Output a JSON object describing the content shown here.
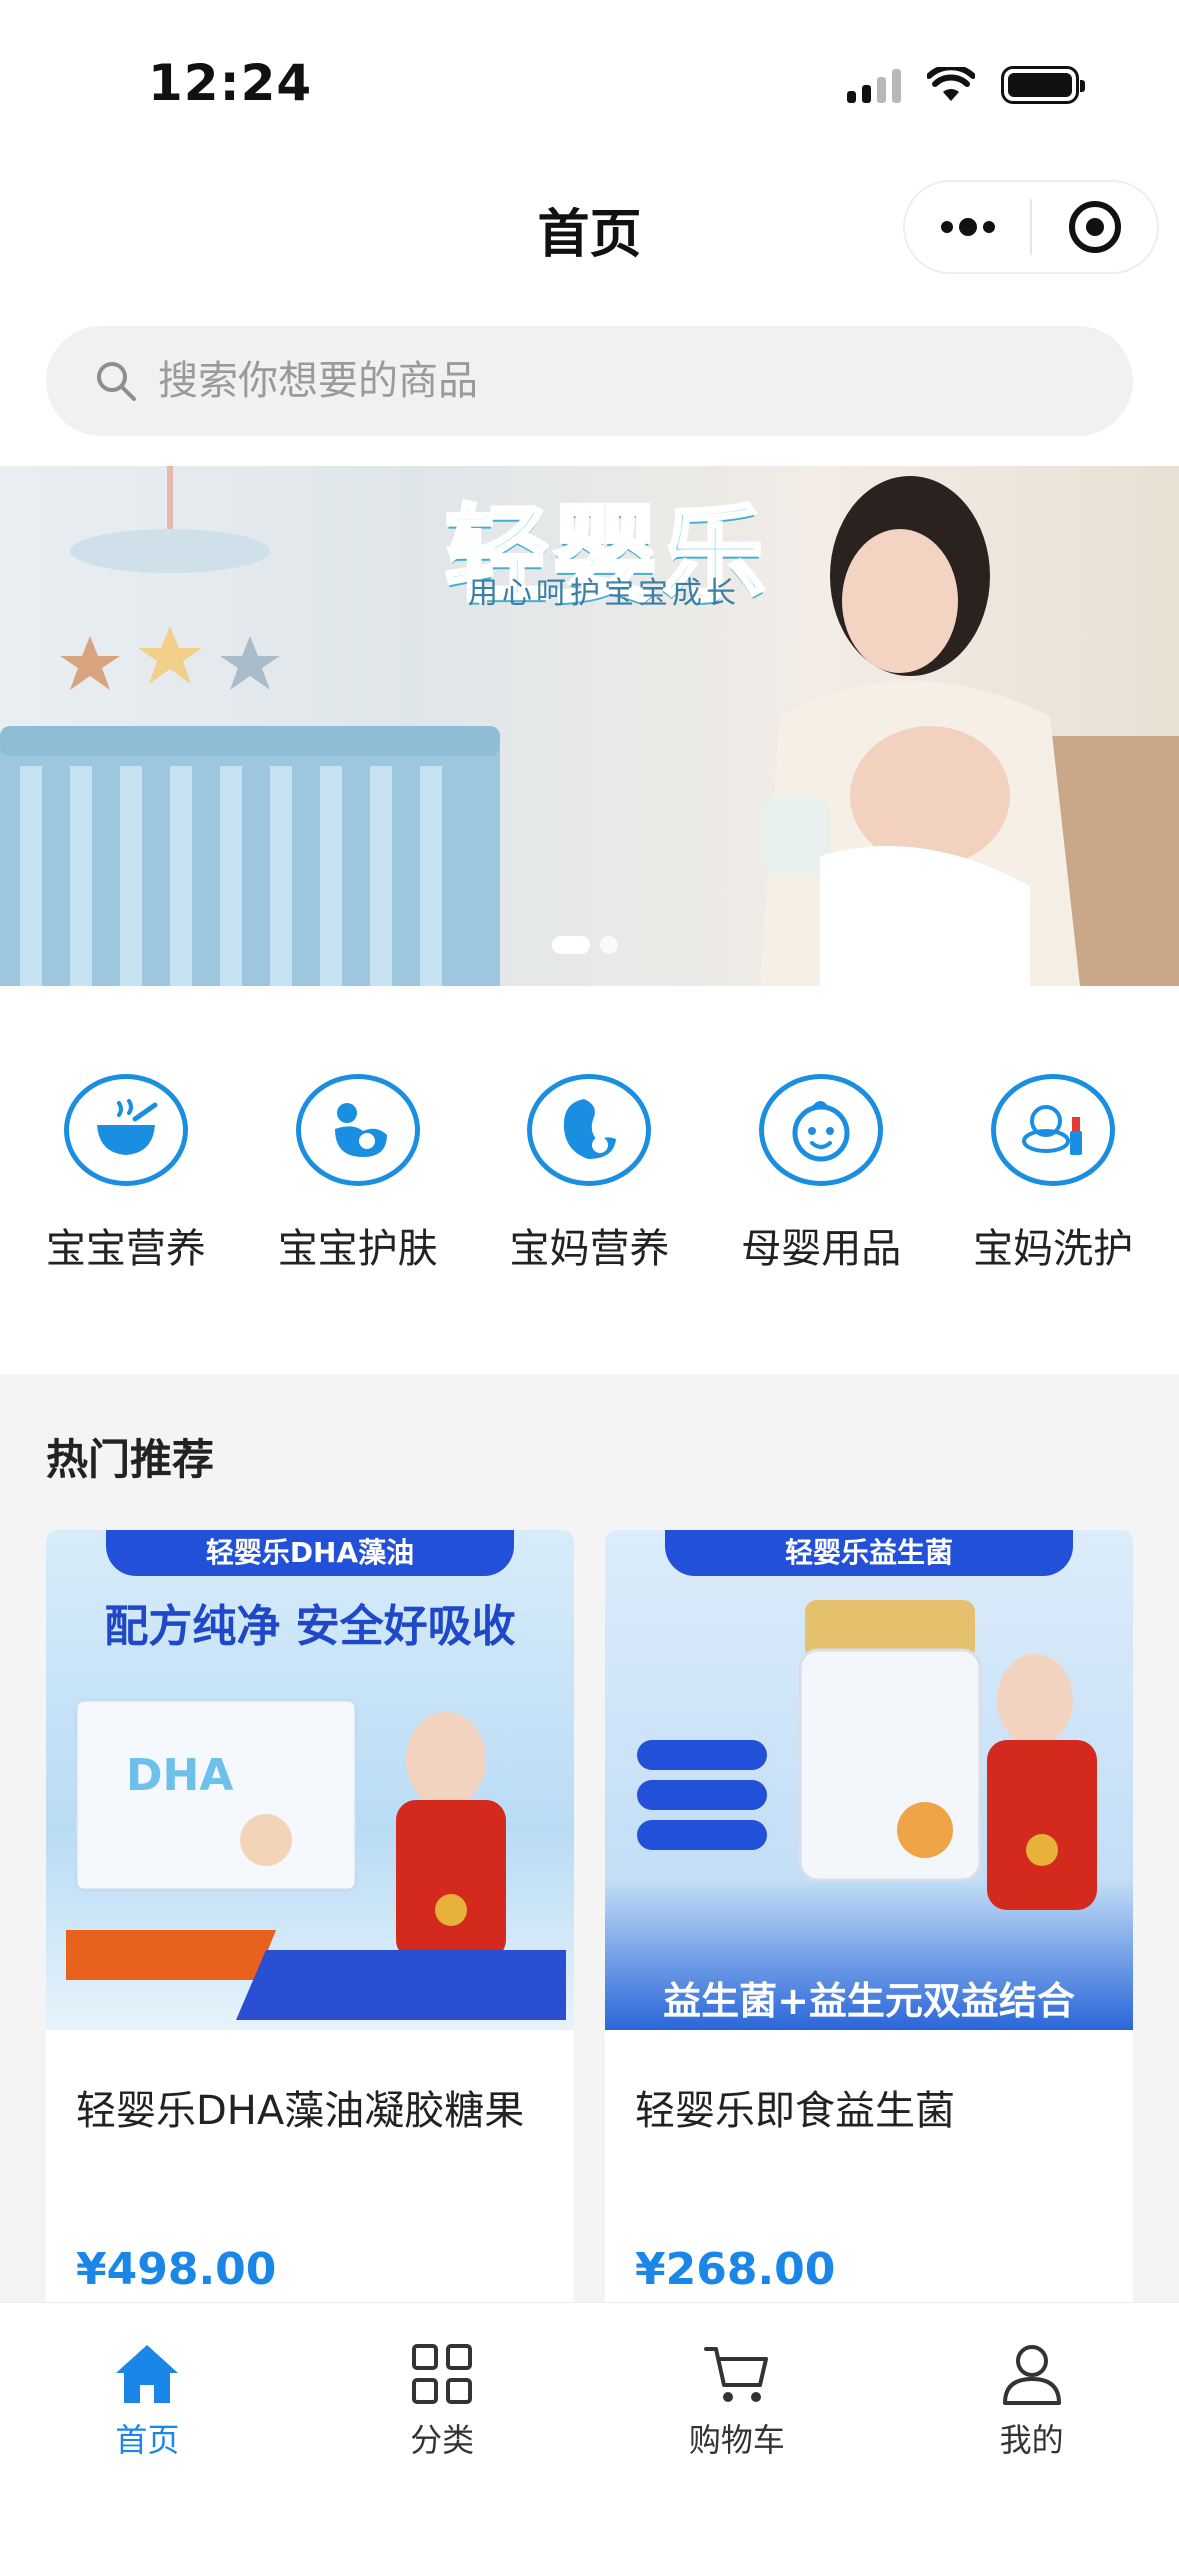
{
  "status_bar": {
    "time": "12:24"
  },
  "nav": {
    "title": "首页"
  },
  "search": {
    "placeholder": "搜索你想要的商品"
  },
  "banner": {
    "brand": "轻婴乐",
    "slogan": "用心呵护宝宝成长",
    "active_slide": 1,
    "slide_count": 2
  },
  "categories": [
    {
      "label": "宝宝营养",
      "icon": "bowl-icon"
    },
    {
      "label": "宝宝护肤",
      "icon": "baby-care-icon"
    },
    {
      "label": "宝妈营养",
      "icon": "mother-icon"
    },
    {
      "label": "母婴用品",
      "icon": "baby-face-icon"
    },
    {
      "label": "宝妈洗护",
      "icon": "cosmetics-icon"
    }
  ],
  "hot": {
    "title": "热门推荐",
    "products": [
      {
        "ribbon": "轻婴乐DHA藻油",
        "headline": "配方纯净 安全好吸收",
        "name": "轻婴乐DHA藻油凝胶糖果",
        "price": "¥498.00"
      },
      {
        "ribbon": "轻婴乐益生菌",
        "headline": "益生菌+益生元双益结合",
        "name": "轻婴乐即食益生菌",
        "price": "¥268.00"
      }
    ]
  },
  "tabbar": {
    "items": [
      {
        "label": "首页",
        "icon": "home-icon",
        "active": true
      },
      {
        "label": "分类",
        "icon": "grid-icon",
        "active": false
      },
      {
        "label": "购物车",
        "icon": "cart-icon",
        "active": false
      },
      {
        "label": "我的",
        "icon": "user-icon",
        "active": false
      }
    ]
  },
  "colors": {
    "accent": "#1a86e8",
    "icon_ring": "#1a8ee0"
  }
}
